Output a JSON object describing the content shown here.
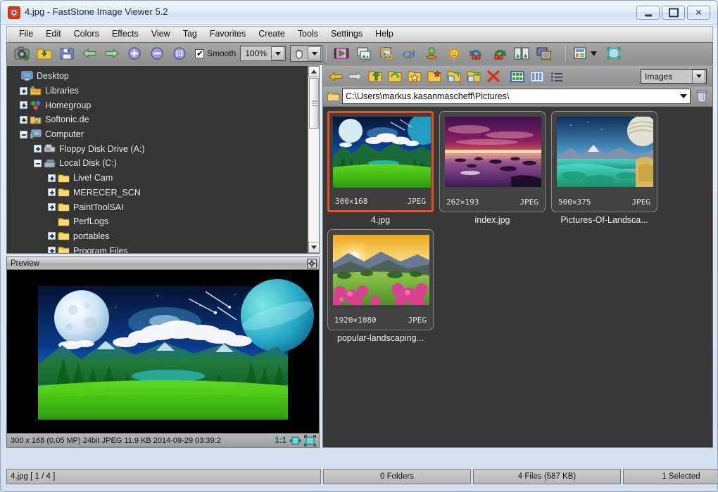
{
  "window": {
    "title": "4.jpg  -  FastStone Image Viewer 5.2",
    "app_icon": "faststone-icon",
    "controls": {
      "minimize": "minimize",
      "maximize": "maximize",
      "close": "close"
    }
  },
  "menu": {
    "items": [
      {
        "label": "File"
      },
      {
        "label": "Edit"
      },
      {
        "label": "Colors"
      },
      {
        "label": "Effects"
      },
      {
        "label": "View"
      },
      {
        "label": "Tag"
      },
      {
        "label": "Favorites"
      },
      {
        "label": "Create"
      },
      {
        "label": "Tools"
      },
      {
        "label": "Settings"
      },
      {
        "label": "Help"
      }
    ]
  },
  "toolbar": {
    "buttons": [
      {
        "name": "screen-capture-icon"
      },
      {
        "name": "open-folder-icon"
      },
      {
        "name": "save-icon"
      },
      {
        "name": "previous-image-icon"
      },
      {
        "name": "next-image-icon"
      },
      {
        "name": "zoom-in-icon"
      },
      {
        "name": "zoom-out-icon"
      },
      {
        "name": "actual-size-icon"
      }
    ],
    "smooth_label": "Smooth",
    "smooth_checked": true,
    "zoom_value": "100%",
    "hand_tool": "hand-icon",
    "right_buttons": [
      {
        "name": "slideshow-icon"
      },
      {
        "name": "compare-icon"
      },
      {
        "name": "crop-icon"
      },
      {
        "name": "draw-board-icon"
      },
      {
        "name": "clone-stamp-icon"
      },
      {
        "name": "adjust-lighting-icon"
      },
      {
        "name": "rotate-left-icon"
      },
      {
        "name": "rotate-right-icon"
      },
      {
        "name": "resize-icon"
      },
      {
        "name": "window-mode-icon"
      },
      {
        "name": "view-mode-icon"
      },
      {
        "name": "fullscreen-icon"
      }
    ]
  },
  "tree": {
    "items": [
      {
        "label": "Desktop",
        "indent": 0,
        "expander": "none",
        "icon": "desktop-icon"
      },
      {
        "label": "Libraries",
        "indent": 1,
        "expander": "plus",
        "icon": "library-folder-icon"
      },
      {
        "label": "Homegroup",
        "indent": 1,
        "expander": "plus",
        "icon": "homegroup-icon"
      },
      {
        "label": "Softonic.de",
        "indent": 1,
        "expander": "plus",
        "icon": "user-folder-icon"
      },
      {
        "label": "Computer",
        "indent": 1,
        "expander": "minus",
        "icon": "computer-icon"
      },
      {
        "label": "Floppy Disk Drive (A:)",
        "indent": 2,
        "expander": "plus",
        "icon": "floppy-drive-icon"
      },
      {
        "label": "Local Disk (C:)",
        "indent": 2,
        "expander": "minus",
        "icon": "hard-drive-icon"
      },
      {
        "label": "Live! Cam",
        "indent": 3,
        "expander": "plus",
        "icon": "folder-icon"
      },
      {
        "label": "MERECER_SCN",
        "indent": 3,
        "expander": "plus",
        "icon": "folder-icon"
      },
      {
        "label": "PaintToolSAI",
        "indent": 3,
        "expander": "plus",
        "icon": "folder-icon"
      },
      {
        "label": "PerfLogs",
        "indent": 3,
        "expander": "none",
        "icon": "folder-icon"
      },
      {
        "label": "portables",
        "indent": 3,
        "expander": "plus",
        "icon": "folder-icon"
      },
      {
        "label": "Program Files",
        "indent": 3,
        "expander": "plus",
        "icon": "folder-icon"
      }
    ]
  },
  "preview": {
    "title": "Preview",
    "expand_icon": "expand-icon",
    "status": "300 x 168 (0.05 MP)  24bit  JPEG   11.9 KB   2014-09-29 03:39:2",
    "ratio": "1:1",
    "fit_icon": "fit-window-icon",
    "actual_icon": "actual-size-icon"
  },
  "browser": {
    "nav_buttons": [
      {
        "name": "back-icon"
      },
      {
        "name": "forward-icon"
      },
      {
        "name": "up-folder-icon"
      },
      {
        "name": "refresh-folder-icon"
      },
      {
        "name": "favorite-folder-icon"
      },
      {
        "name": "new-folder-icon"
      },
      {
        "name": "copy-to-folder-icon"
      },
      {
        "name": "move-to-folder-icon"
      },
      {
        "name": "delete-icon"
      },
      {
        "name": "thumbnail-view-icon"
      },
      {
        "name": "detail-view-icon"
      },
      {
        "name": "list-view-icon"
      }
    ],
    "filter_value": "Images",
    "address": "C:\\Users\\markus.kasanmascheff\\Pictures\\",
    "address_folder_icon": "folder-icon",
    "trash_icon": "trash-icon"
  },
  "thumbnails": [
    {
      "name": "4.jpg",
      "dimensions": "300×168",
      "format": "JPEG",
      "selected": true,
      "image": "moon-over-green-valley"
    },
    {
      "name": "index.jpg",
      "dimensions": "262×193",
      "format": "JPEG",
      "selected": false,
      "image": "purple-sunset-lake"
    },
    {
      "name": "Pictures-Of-Landsca...",
      "dimensions": "500×375",
      "format": "JPEG",
      "selected": false,
      "image": "saturn-over-turquoise-lake"
    },
    {
      "name": "popular-landscaping...",
      "dimensions": "1920×1080",
      "format": "JPEG",
      "selected": false,
      "image": "sunrise-over-flower-hills"
    }
  ],
  "status_bar": {
    "file": "4.jpg [ 1 / 4 ]",
    "folders": "0 Folders",
    "files": "4 Files (587 KB)",
    "selected": "1 Selected",
    "extra": ""
  },
  "colors": {
    "selection_orange": "#e8521f",
    "pane_background": "#383838",
    "tree_background": "#353535",
    "toolbar_gray": "#9a9a9a",
    "teal_accent": "#006a6a"
  }
}
